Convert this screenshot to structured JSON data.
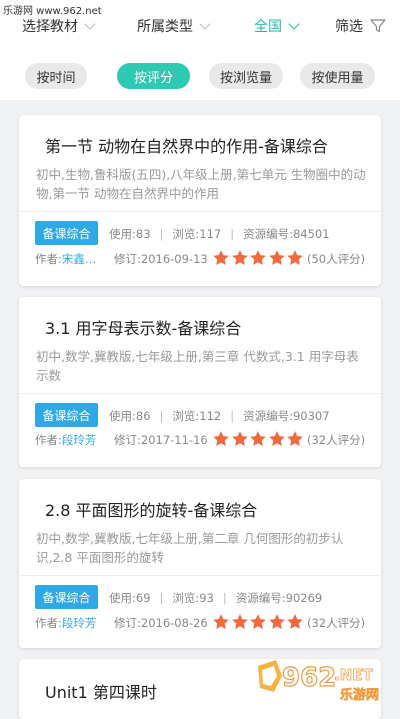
{
  "watermark_top": "乐游网 www.962.net",
  "filters": {
    "textbook": "选择教材",
    "type": "所属类型",
    "region": "全国",
    "screen": "筛选"
  },
  "sort": {
    "by_time": "按时间",
    "by_rating": "按评分",
    "by_views": "按浏览量",
    "by_usage": "按使用量"
  },
  "colors": {
    "accent": "#2ec9b2",
    "tag_blue": "#2fa9e6",
    "star_orange": "#f0693f"
  },
  "cards": [
    {
      "title": "第一节 动物在自然界中的作用-备课综合",
      "desc": "初中,生物,鲁科版(五四),八年级上册,第七单元 生物圈中的动物,第一节 动物在自然界中的作用",
      "tag": "备课综合",
      "usage": "使用:83",
      "views": "浏览:117",
      "code": "资源编号:84501",
      "author_label": "作者:",
      "author": "宋鑫…",
      "revised": "修订:2016-09-13",
      "rating": 5,
      "rating_count": "(50人评分)"
    },
    {
      "title": "3.1 用字母表示数-备课综合",
      "desc": "初中,数学,冀教版,七年级上册,第三章 代数式,3.1 用字母表示数",
      "tag": "备课综合",
      "usage": "使用:86",
      "views": "浏览:112",
      "code": "资源编号:90307",
      "author_label": "作者:",
      "author": "段玲芳",
      "revised": "修订:2017-11-16",
      "rating": 5,
      "rating_count": "(32人评分)"
    },
    {
      "title": "2.8 平面图形的旋转-备课综合",
      "desc": "初中,数学,冀教版,七年级上册,第二章 几何图形的初步认识,2.8 平面图形的旋转",
      "tag": "备课综合",
      "usage": "使用:69",
      "views": "浏览:93",
      "code": "资源编号:90269",
      "author_label": "作者:",
      "author": "段玲芳",
      "revised": "修订:2016-08-26",
      "rating": 5,
      "rating_count": "(32人评分)"
    },
    {
      "title": "Unit1 第四课时"
    }
  ],
  "watermark_br": {
    "logo": "962",
    "net": ".NET",
    "site": "乐游网"
  }
}
